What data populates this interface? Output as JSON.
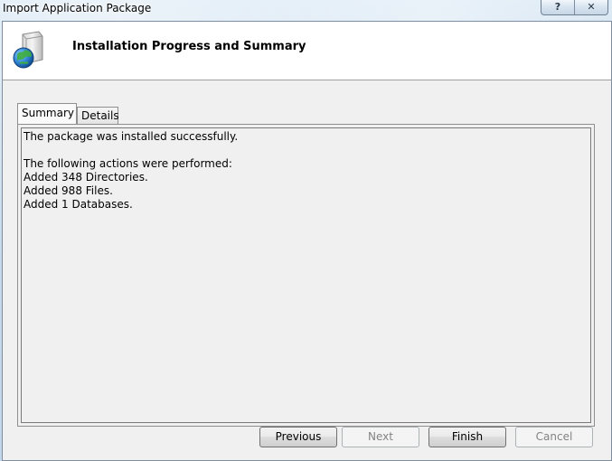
{
  "window": {
    "title": "Import Application Package",
    "help_label": "?",
    "close_label": "✕"
  },
  "header": {
    "title": "Installation Progress and Summary",
    "icon": "package-globe-icon"
  },
  "tabs": [
    {
      "label": "Summary",
      "active": true
    },
    {
      "label": "Details",
      "active": false
    }
  ],
  "summary": {
    "lines": [
      "The package was installed successfully.",
      "",
      "The following actions were performed:",
      "Added 348 Directories.",
      "Added 988 Files.",
      "Added 1 Databases."
    ]
  },
  "buttons": {
    "previous": "Previous",
    "next": "Next",
    "finish": "Finish",
    "cancel": "Cancel"
  }
}
